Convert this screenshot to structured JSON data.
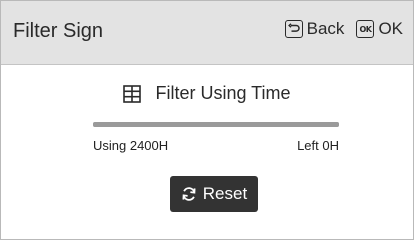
{
  "header": {
    "title": "Filter Sign",
    "back_label": "Back",
    "ok_icon_text": "OK",
    "ok_label": "OK"
  },
  "main": {
    "heading": "Filter Using Time",
    "usage_label": "Using 2400H",
    "left_label": "Left 0H",
    "progress_fraction": 1.0,
    "reset_label": "Reset"
  },
  "icons": {
    "back": "back-return-icon",
    "ok": "ok-icon",
    "filter": "grid-icon",
    "reset": "refresh-icon"
  },
  "colors": {
    "header_bg": "#e3e3e3",
    "reset_button_bg": "#333333",
    "progress_track": "#c8c8c8",
    "progress_fill": "#9a9a9a"
  }
}
